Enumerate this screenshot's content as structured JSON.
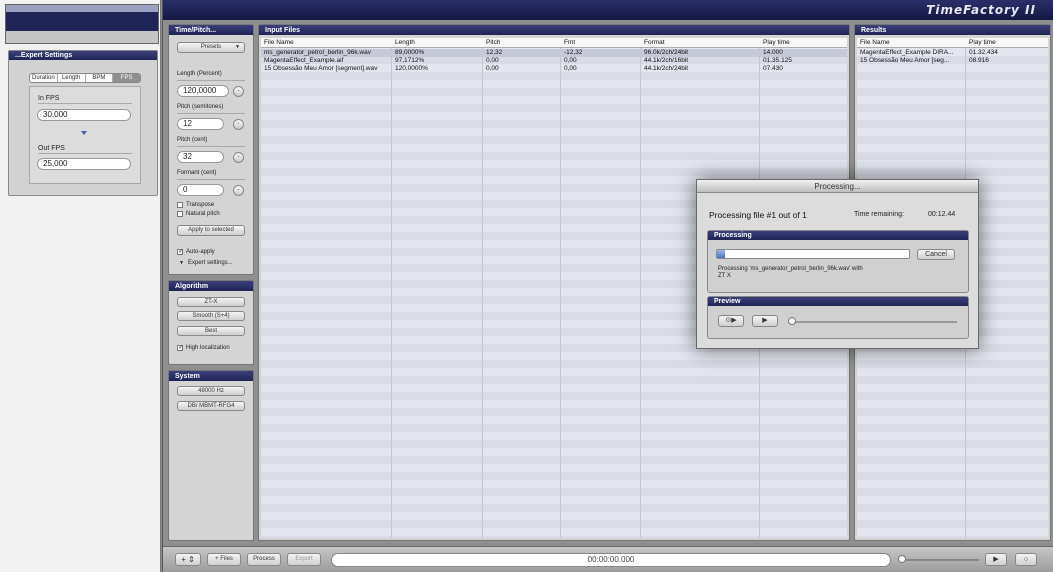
{
  "expert": {
    "title": "...Expert Settings",
    "tabs": [
      "Duration",
      "Length",
      "BPM",
      "FPS"
    ],
    "in_label": "In FPS",
    "in_value": "30,000",
    "out_label": "Out FPS",
    "out_value": "25,000"
  },
  "app": {
    "title": "TimeFactory II"
  },
  "timepitch": {
    "title": "Time/Pitch...",
    "presets": "Presets",
    "length_label": "Length (Percent)",
    "length_value": "120,0000",
    "pitch_semi_label": "Pitch (semitones)",
    "pitch_semi_value": "12",
    "pitch_cent_label": "Pitch (cent)",
    "pitch_cent_value": "32",
    "formant_label": "Formant (cent)",
    "formant_value": "0",
    "transpose": "Transpose",
    "natural_pitch": "Natural pitch",
    "apply": "Apply to selected",
    "auto_apply": "Auto-apply",
    "expert_settings": "Expert settings..."
  },
  "algorithm": {
    "title": "Algorithm",
    "buttons": [
      "ZT-X",
      "Smooth (S+4)",
      "Best"
    ],
    "high_localization": "High localization"
  },
  "system": {
    "title": "System",
    "buttons": [
      "48000 Hz",
      "DB/ MBMT-RFG4"
    ]
  },
  "input_files": {
    "title": "Input Files",
    "columns": [
      "File Name",
      "Length",
      "Pitch",
      "Fmt",
      "Format",
      "Play time"
    ],
    "rows": [
      [
        "ms_generator_petrol_berlin_96k.wav",
        "89,0000%",
        "12,32",
        "-12,32",
        "96.0k/2ch/24bit",
        "14.000"
      ],
      [
        "MagentaEffect_Example.aif",
        "97,1712%",
        "0,00",
        "0,00",
        "44.1k/2ch/16bit",
        "01.35.125"
      ],
      [
        "15 Obsessão Meu Amor [segment].wav",
        "120,0000%",
        "0,00",
        "0,00",
        "44.1k/2ch/24bit",
        "07.430"
      ]
    ]
  },
  "results": {
    "title": "Results",
    "columns": [
      "File Name",
      "Play time"
    ],
    "rows": [
      [
        "MagentaEffect_Example DIRA...",
        "01.32.434"
      ],
      [
        "15 Obsessão Meu Amor [seg...",
        "08.916"
      ]
    ]
  },
  "dialog": {
    "title": "Processing...",
    "heading": "Processing file #1 out of 1",
    "time_label": "Time remaining:",
    "time_value": "00:12.44",
    "processing_title": "Processing",
    "cancel": "Cancel",
    "status_line1": "Processing 'ms_generator_petrol_berlin_96k.wav' with",
    "status_line2": "ZT X",
    "progress": 0.04,
    "preview_title": "Preview"
  },
  "bottom": {
    "add_files": "+ Files",
    "process": "Process",
    "export": "Export",
    "timecode": "00:00:00.000"
  }
}
